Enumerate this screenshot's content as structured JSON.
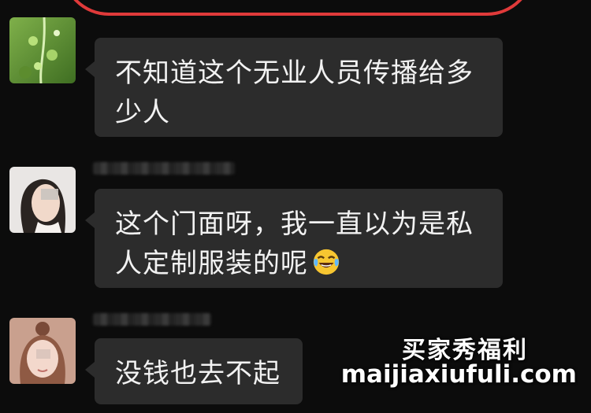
{
  "messages": [
    {
      "text": "不知道这个无业人员传播给多少人",
      "line1": "不知道这个无业人员传播给多",
      "line2": "少人",
      "avatar_icon": "nature-plant-avatar"
    },
    {
      "line1": "这个门面呀，我一直以为是私",
      "line2": "人定制服装的呢",
      "emoji": "laughing-crying-face-emoji",
      "avatar_icon": "woman-portrait-avatar"
    },
    {
      "line1": "没钱也去不起",
      "avatar_icon": "girl-portrait-avatar"
    }
  ],
  "watermark": {
    "cn": "买家秀福利",
    "url": "maijiaxiufuli.com"
  },
  "colors": {
    "background": "#0c0c0c",
    "bubble": "#2c2c2c",
    "text": "#f2f2f2",
    "highlight_mark": "#e03a3a"
  }
}
